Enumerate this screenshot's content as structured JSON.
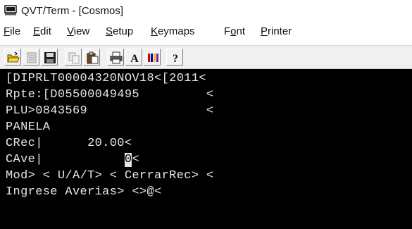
{
  "window": {
    "title": "QVT/Term - [Cosmos]"
  },
  "menu": [
    {
      "label": "File",
      "mnemonic": "F",
      "rest": "ile"
    },
    {
      "label": "Edit",
      "mnemonic": "E",
      "rest": "dit"
    },
    {
      "label": "View",
      "mnemonic": "V",
      "rest": "iew"
    },
    {
      "label": "Setup",
      "mnemonic": "S",
      "rest": "etup"
    },
    {
      "label": "Keymaps",
      "mnemonic": "K",
      "rest": "eymaps"
    },
    {
      "label": "Font",
      "pre": "F",
      "mnemonic": "o",
      "rest": "nt"
    },
    {
      "label": "Printer",
      "mnemonic": "P",
      "rest": "rinter"
    }
  ],
  "toolbar": {
    "buttons": [
      "open-folder-icon",
      "disabled-doc-icon",
      "save-icon",
      "copy-icon",
      "paste-icon",
      "print-icon",
      "font-icon",
      "colors-icon",
      "help-icon"
    ],
    "font_glyph": "A",
    "help_glyph": "?",
    "colors": {
      "red": "#d40000",
      "blue": "#0000cc",
      "yellow": "#e0c000",
      "purple": "#7a1fa2"
    }
  },
  "terminal": {
    "lines": [
      "[DIPRLT00004320NOV18<[2011<",
      "Rpte:[D05500049495         <",
      "PLU>0843569                <",
      "PANELA",
      "CRec|      20.00<",
      "CAve|           ",
      "Mod> < U/A/T> < CerrarRec> <",
      "Ingrese Averias> <>@<"
    ],
    "cursor_line": {
      "before": "CAve|           ",
      "cursor_char": "0",
      "after": "<"
    }
  }
}
